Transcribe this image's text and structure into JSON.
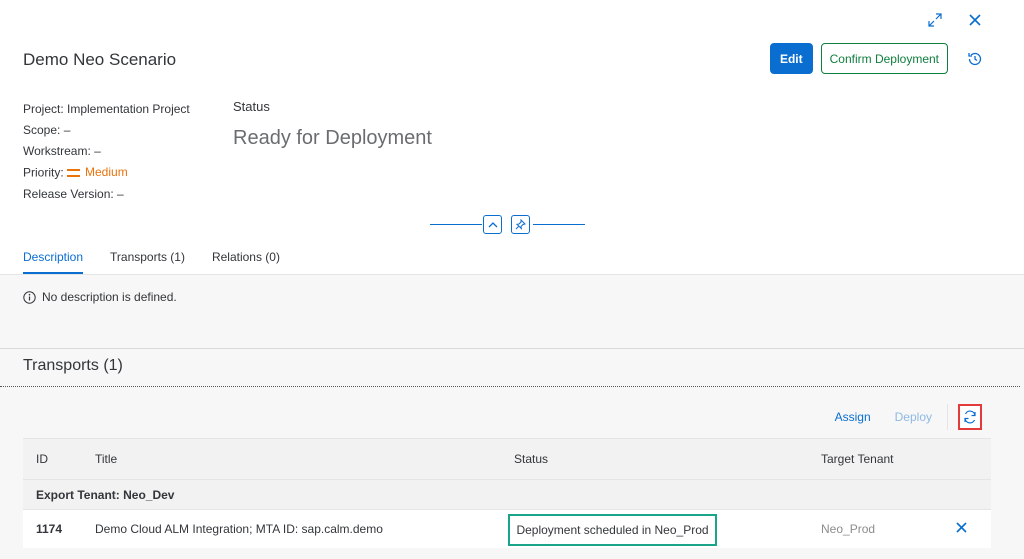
{
  "window": {
    "expand_icon": "expand-icon",
    "close_icon": "close-icon"
  },
  "header": {
    "title": "Demo Neo Scenario",
    "edit_label": "Edit",
    "confirm_label": "Confirm Deployment",
    "history_icon": "history-icon"
  },
  "attributes": {
    "project": "Project: Implementation Project",
    "scope": "Scope: –",
    "workstream": "Workstream: –",
    "priority_label": "Priority:",
    "priority_value": "Medium",
    "release": "Release Version: –"
  },
  "status": {
    "label": "Status",
    "value": "Ready for Deployment"
  },
  "tabs": [
    {
      "label": "Description",
      "active": true
    },
    {
      "label": "Transports (1)",
      "active": false
    },
    {
      "label": "Relations (0)",
      "active": false
    }
  ],
  "description": {
    "text": "No description is defined."
  },
  "transports": {
    "title": "Transports (1)",
    "toolbar": {
      "assign": "Assign",
      "deploy": "Deploy",
      "refresh_icon": "refresh-icon"
    },
    "columns": [
      "ID",
      "Title",
      "Status",
      "Target Tenant"
    ],
    "group": "Export Tenant: Neo_Dev",
    "rows": [
      {
        "id": "1174",
        "title": "Demo Cloud ALM Integration; MTA ID: sap.calm.demo",
        "status": "Deployment scheduled in Neo_Prod",
        "tenant": "Neo_Prod"
      }
    ]
  },
  "colors": {
    "accent": "#0a6ed1",
    "positive": "#107e3e",
    "priority": "#e9730c",
    "highlight_red": "#e33b3b",
    "highlight_green": "#1aa58a"
  }
}
